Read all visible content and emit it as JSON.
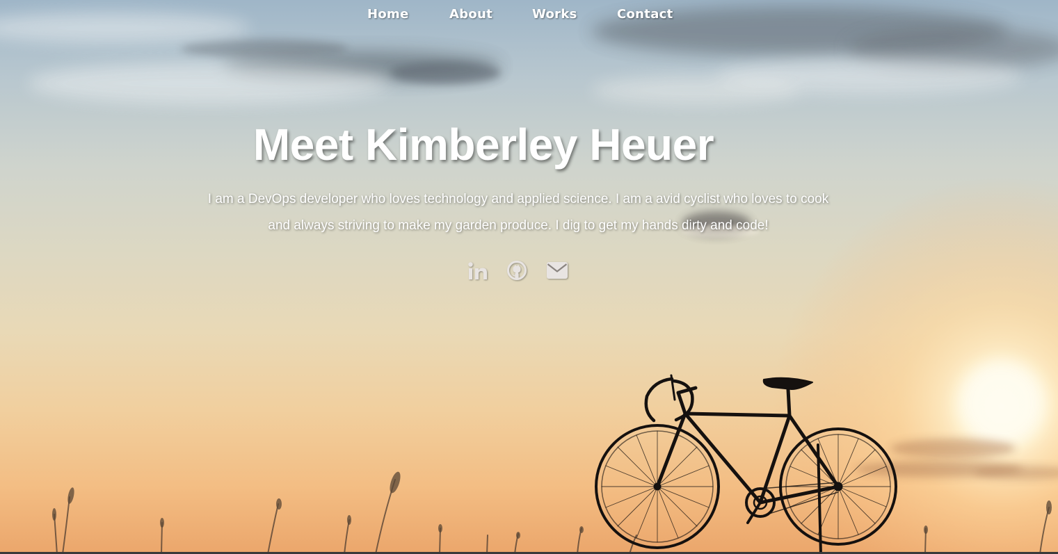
{
  "nav": {
    "items": [
      {
        "label": "Home"
      },
      {
        "label": "About"
      },
      {
        "label": "Works"
      },
      {
        "label": "Contact"
      }
    ]
  },
  "hero": {
    "title": "Meet Kimberley Heuer",
    "bio": "I am a DevOps developer who loves technology and applied science. I am a avid cyclist who loves to cook and always striving to make my garden produce. I dig to get my hands dirty and code!"
  },
  "social": {
    "items": [
      {
        "icon": "linkedin-icon"
      },
      {
        "icon": "github-icon"
      },
      {
        "icon": "envelope-icon"
      }
    ]
  },
  "colors": {
    "text": "#ffffff",
    "icon": "#e8e4e2",
    "silhouette": "#15110f",
    "sun": "#fff6dc"
  }
}
